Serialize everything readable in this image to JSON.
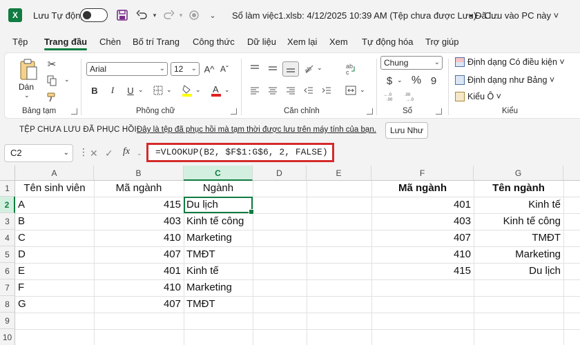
{
  "titlebar": {
    "app_badge": "X",
    "autosave_label": "Lưu Tự động",
    "document_title": "Sổ làm việc1.xlsb: 4/12/2025 10:39 AM (Tệp chưa được Lưu)  -  C...",
    "saved_status": "• Đã lưu vào PC này ˅"
  },
  "tabs": [
    "Tệp",
    "Trang đầu",
    "Chèn",
    "Bố trí Trang",
    "Công thức",
    "Dữ liệu",
    "Xem lại",
    "Xem",
    "Tự động hóa",
    "Trợ giúp"
  ],
  "ribbon": {
    "clipboard": {
      "paste_label": "Dán",
      "group_label": "Bảng tạm"
    },
    "font": {
      "font_name": "Arial",
      "font_size": "12",
      "group_label": "Phông chữ",
      "grow": "A^",
      "shrink": "Aˇ",
      "bold": "B",
      "italic": "I",
      "underline": "U"
    },
    "alignment": {
      "group_label": "Căn chỉnh"
    },
    "number": {
      "format": "Chung",
      "currency": "$",
      "percent": "%",
      "comma": "9",
      "group_label": "Số"
    },
    "styles": {
      "conditional": "Định dạng Có điều kiện ˅",
      "as_table": "Định dạng như Bảng ˅",
      "cell_styles": "Kiểu Ô ˅",
      "group_label": "Kiểu"
    }
  },
  "recovery": {
    "title": "TỆP CHƯA LƯU ĐÃ PHỤC HỒI",
    "message": "Đây là tệp đã phục hồi mà tạm thời được lưu trên máy tính của bạn.",
    "button": "Lưu Như"
  },
  "formula_bar": {
    "name_box": "C2",
    "fx": "fx",
    "formula": "=VLOOKUP(B2, $F$1:G$6, 2, FALSE)"
  },
  "grid": {
    "columns": [
      "A",
      "B",
      "C",
      "D",
      "E",
      "F",
      "G"
    ],
    "rows": [
      "1",
      "2",
      "3",
      "4",
      "5",
      "6",
      "7",
      "8",
      "9",
      "10"
    ],
    "cells": {
      "A1": "Tên sinh viên",
      "B1": "Mã ngành",
      "C1": "Ngành",
      "F1": "Mã ngành",
      "G1": "Tên ngành",
      "A2": "A",
      "B2": "415",
      "C2": "Du lịch",
      "F2": "401",
      "G2": "Kinh tế",
      "A3": "B",
      "B3": "403",
      "C3": "Kinh tế công",
      "F3": "403",
      "G3": "Kinh tế công",
      "A4": "C",
      "B4": "410",
      "C4": "Marketing",
      "F4": "407",
      "G4": "TMĐT",
      "A5": "D",
      "B5": "407",
      "C5": "TMĐT",
      "F5": "410",
      "G5": "Marketing",
      "A6": "E",
      "B6": "401",
      "C6": "Kinh tế",
      "F6": "415",
      "G6": "Du lịch",
      "A7": "F",
      "B7": "410",
      "C7": "Marketing",
      "A8": "G",
      "B8": "407",
      "C8": "TMĐT"
    },
    "selected_cell": "C2"
  },
  "colors": {
    "accent": "#107c41",
    "highlight_border": "#d42a2a"
  }
}
